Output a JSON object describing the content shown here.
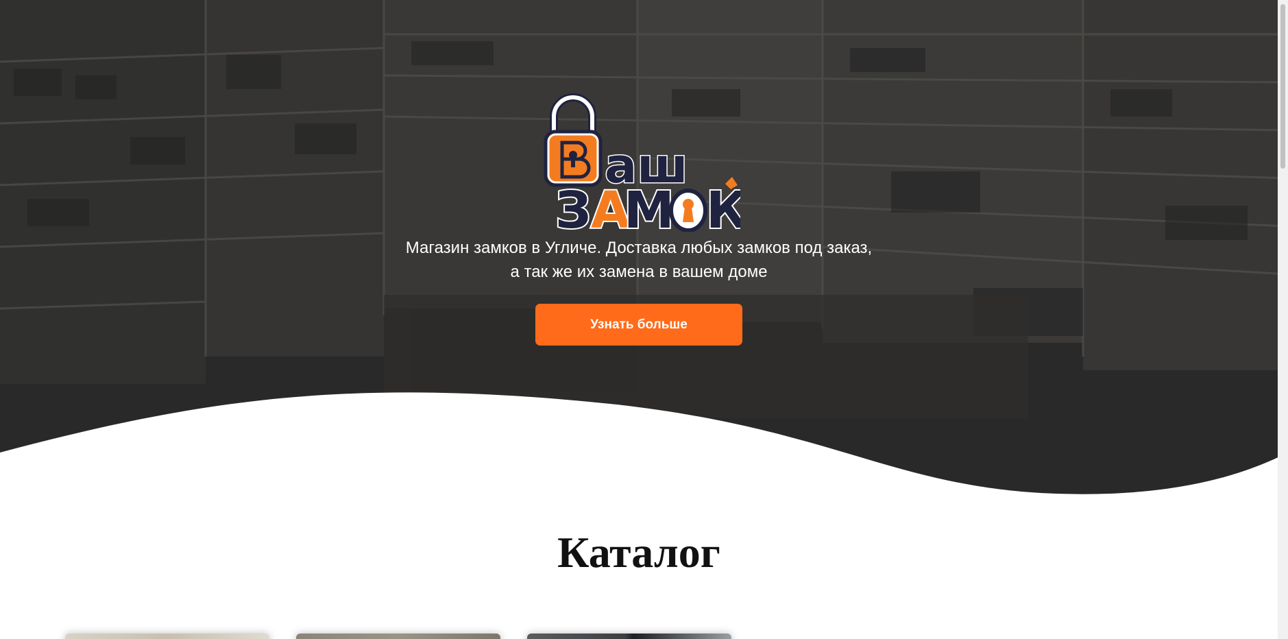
{
  "hero": {
    "logo": {
      "line1": "Ваш",
      "line2": "ЗАМОК",
      "accent_color": "#f47c20",
      "outline_color": "#1f2340"
    },
    "tagline": "Магазин замков в Угличе. Доставка любых замков под заказ, а так же их замена в вашем доме",
    "cta_label": "Узнать больше",
    "cta_color": "#ff6b1a",
    "background": "lock-store-shelves-photo"
  },
  "catalog": {
    "title": "Каталог",
    "cards": [
      {
        "image": "catalog-card-image-1"
      },
      {
        "image": "catalog-card-image-2"
      },
      {
        "image": "catalog-card-image-3"
      }
    ]
  }
}
